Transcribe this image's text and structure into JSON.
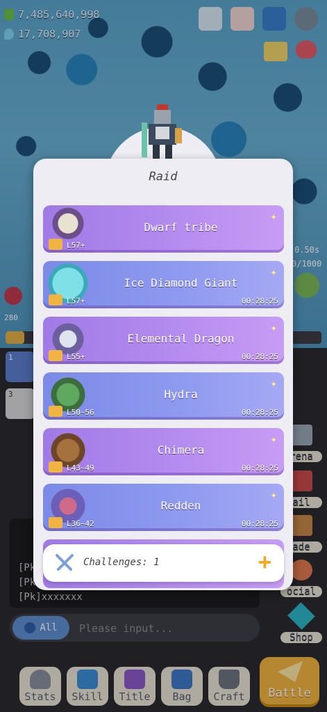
{
  "resources": {
    "gold": "7,485,640,998",
    "crystal": "17,708,907"
  },
  "raid": {
    "title": "Raid",
    "bosses": [
      {
        "name": "Dwarf tribe",
        "level": "L57+",
        "time": ""
      },
      {
        "name": "Ice Diamond Giant",
        "level": "L57+",
        "time": "00:28:25"
      },
      {
        "name": "Elemental Dragon",
        "level": "L55+",
        "time": "00:28:25"
      },
      {
        "name": "Hydra",
        "level": "L50~56",
        "time": "00:28:25"
      },
      {
        "name": "Chimera",
        "level": "L43~49",
        "time": "00:28:25"
      },
      {
        "name": "Redden",
        "level": "L36~42",
        "time": "00:28:25"
      }
    ],
    "challenges": "Challenges: 1"
  },
  "chat": {
    "lines": [
      "[Pk]",
      "[Pk]",
      "[Pk]xxxxxxx"
    ],
    "channel": "All",
    "placeholder": "Please input..."
  },
  "side_buttons": {
    "arena": "rena",
    "mail": "ail",
    "trade": "ade",
    "social": "ocial",
    "shop": "Shop"
  },
  "nav": {
    "stats": "Stats",
    "skill": "Skill",
    "title": "Title",
    "bag": "Bag",
    "craft": "Craft",
    "battle": "Battle"
  },
  "misc": {
    "timer": "0.50s",
    "count": "0/1000",
    "slot1": "1",
    "slot3": "3",
    "level_left": "280"
  },
  "colors": {
    "card_purple": "#b68df0",
    "card_blue": "#8f9bf0",
    "battle": "#f0b540",
    "plus": "#f5a623"
  }
}
